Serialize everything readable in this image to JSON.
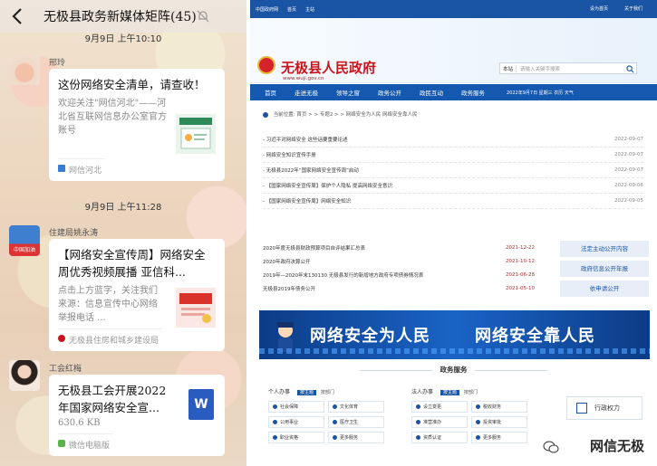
{
  "chat": {
    "title": "无极县政务新媒体矩阵(45)",
    "time1": "9月9日 上午10:10",
    "time2": "9月9日 上午11:28",
    "messages": [
      {
        "sender": "邢玲",
        "title": "这份网络安全清单，请查收！",
        "desc": "欢迎关注\"网信河北\"——河北省互联网信息办公室官方账号",
        "source": "网信河北"
      },
      {
        "sender": "住建局姚永涛",
        "avatar_text": "中国加油",
        "title": "【网络安全宣传周】网络安全周优秀视频展播  亚信科...",
        "desc": "点击上方蓝字，关注我们来源：信息宣传中心网络举报电话 ...",
        "source": "无极县住房和城乡建设局"
      },
      {
        "sender": "工会红梅",
        "title": "无极县工会开展2022年国家网络安全宣...",
        "size": "630.6 KB",
        "file_icon": "W",
        "source": "微信电脑版"
      }
    ]
  },
  "site": {
    "topbar_left": [
      "中国政府网",
      "首页",
      "主站"
    ],
    "topbar_right": [
      "设为首页",
      "关于我们"
    ],
    "name": "无极县人民政府",
    "url": "www.wuji.gov.cn",
    "search_scope": "本站",
    "search_placeholder": "请输入关键字搜索",
    "nav": [
      "首页",
      "走进无极",
      "领导之窗",
      "政务公开",
      "政民互动",
      "政务服务"
    ],
    "nav_date": "2022年9月7日 星期三 农历 天气",
    "breadcrumb": "当前位置: 首页 > > 专题2 > > 网络安全为人民 网络安全靠人民",
    "news": [
      {
        "title": "- 习近平对网络安全 这些话要重要论述",
        "date": "2022-09-07"
      },
      {
        "title": "- 网络安全知识宣传手册",
        "date": "2022-09-07"
      },
      {
        "title": "- 无极县2022年“国家网络安全宣传周”启动",
        "date": "2022-09-07"
      },
      {
        "title": "- 【国家网络安全宣传周】保护个人隐私 提高网络安全意识",
        "date": "2022-09-06"
      },
      {
        "title": "- 【国家网络安全宣传周】网络安全知识",
        "date": "2022-09-05"
      }
    ],
    "list2": [
      {
        "title": "2020年度无极县财政预算项目自评结果汇总表",
        "date": "2021-12-22"
      },
      {
        "title": "2020年政府决算公开",
        "date": "2021-10-12"
      },
      {
        "title": "2019年—2020年末130130 无极县发行的新增地方政府专项债券情况表",
        "date": "2021-06-28"
      },
      {
        "title": "无极县2019年债务公开",
        "date": "2021-05-10"
      }
    ],
    "side_buttons": [
      "法定主动公开内容",
      "政府信息公开年报",
      "依申请公开"
    ],
    "slogan_left": "网络安全为人民",
    "slogan_right": "网络安全靠人民",
    "services_title": "政务服务",
    "personal": {
      "head": "个人办事",
      "tag1": "按主题",
      "tag2": "按部门",
      "items": [
        "社会保障",
        "文化体育",
        "公用事业",
        "医疗卫生",
        "职业资格",
        "更多服务"
      ]
    },
    "legal": {
      "head": "法人办事",
      "tag1": "按主题",
      "tag2": "按部门",
      "items": [
        "设立变更",
        "税收财务",
        "准营准办",
        "投资审批",
        "资质认证",
        "更多服务"
      ]
    },
    "power_button": "行政权力"
  },
  "watermark": "网信无极",
  "colors": {
    "brand_red": "#c8161d",
    "nav_blue": "#1558b0",
    "accent": "#1a55a5"
  }
}
